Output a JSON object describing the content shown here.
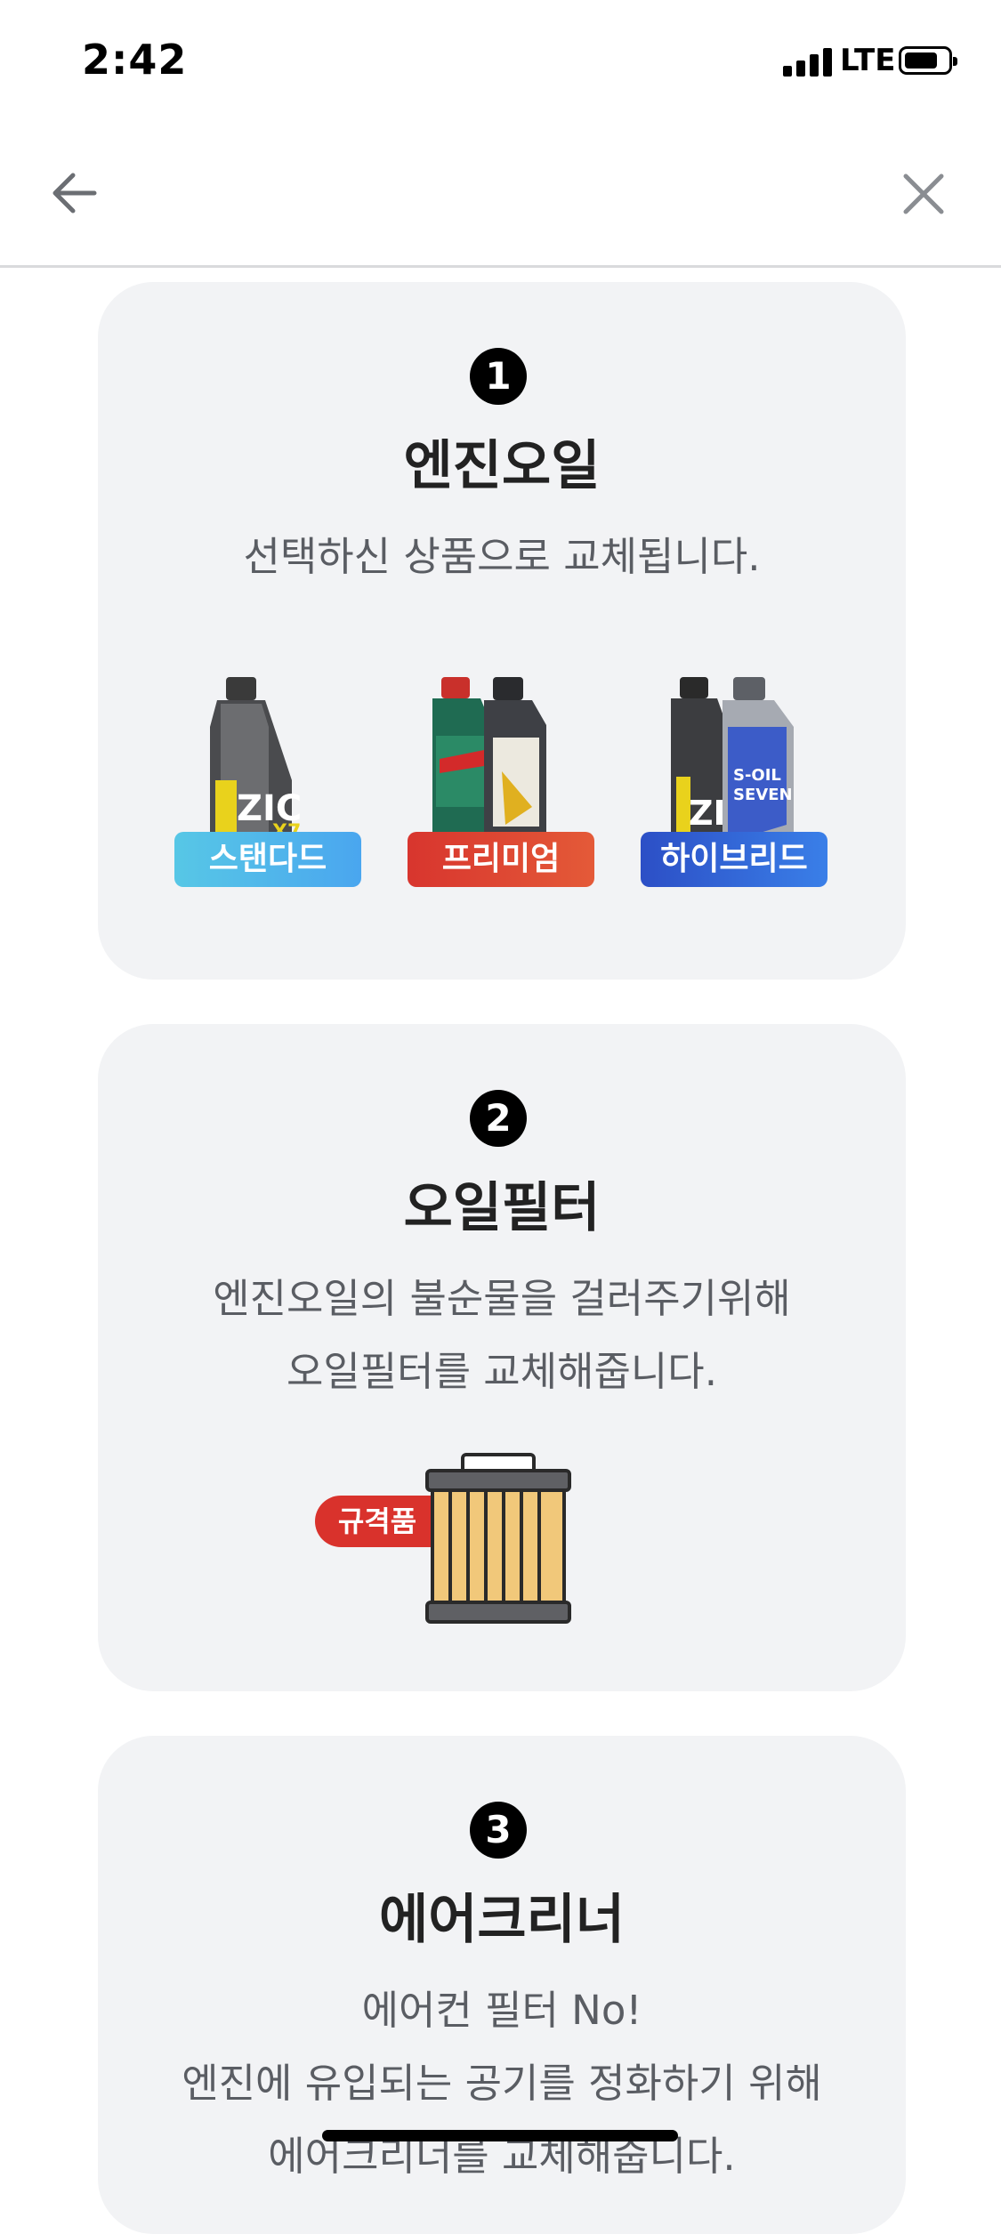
{
  "status_bar": {
    "time": "2:42",
    "network": "LTE"
  },
  "nav": {
    "back_icon": "arrow-left-icon",
    "close_icon": "close-icon"
  },
  "cards": [
    {
      "number": "1",
      "title": "엔진오일",
      "description_lines": [
        "선택하신 상품으로 교체됩니다."
      ],
      "products": [
        {
          "label": "스탠다드",
          "image": "zic-x7-oil-bottle"
        },
        {
          "label": "프리미엄",
          "image": "castrol-fuchs-oil-bottles"
        },
        {
          "label": "하이브리드",
          "image": "zic-s-oil-seven-bottles"
        }
      ]
    },
    {
      "number": "2",
      "title": "오일필터",
      "description_lines": [
        "엔진오일의 불순물을 걸러주기위해",
        "오일필터를 교체해줍니다."
      ],
      "filter_tag": "규격품",
      "image": "oil-filter-illustration"
    },
    {
      "number": "3",
      "title": "에어크리너",
      "description_lines": [
        "에어컨 필터 No!",
        "엔진에 유입되는 공기를 정화하기 위해",
        "에어크리너를 교체해줍니다."
      ]
    }
  ],
  "colors": {
    "card_bg": "#f2f3f5",
    "standard_tag": "#4fb5ea",
    "premium_tag": "#dd4232",
    "hybrid_tag": "#3366d6",
    "filter_tag": "#d9322c"
  }
}
